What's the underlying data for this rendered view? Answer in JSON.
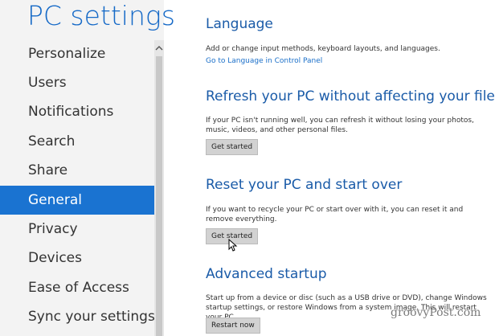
{
  "app_title": "PC settings",
  "sidebar": {
    "items": [
      {
        "label": "Personalize",
        "selected": false
      },
      {
        "label": "Users",
        "selected": false
      },
      {
        "label": "Notifications",
        "selected": false
      },
      {
        "label": "Search",
        "selected": false
      },
      {
        "label": "Share",
        "selected": false
      },
      {
        "label": "General",
        "selected": true
      },
      {
        "label": "Privacy",
        "selected": false
      },
      {
        "label": "Devices",
        "selected": false
      },
      {
        "label": "Ease of Access",
        "selected": false
      },
      {
        "label": "Sync your settings",
        "selected": false
      }
    ]
  },
  "sections": {
    "language": {
      "heading": "Language",
      "desc": "Add or change input methods, keyboard layouts, and languages.",
      "link": "Go to Language in Control Panel"
    },
    "refresh": {
      "heading": "Refresh your PC without affecting your files",
      "desc": "If your PC isn't running well, you can refresh it without losing your photos, music, videos, and other personal files.",
      "button": "Get started"
    },
    "reset": {
      "heading": "Reset your PC and start over",
      "desc": "If you want to recycle your PC or start over with it, you can reset it and remove everything.",
      "button": "Get started"
    },
    "advanced": {
      "heading": "Advanced startup",
      "desc": "Start up from a device or disc (such as a USB drive or DVD), change Windows startup settings, or restore Windows from a system image. This will restart your PC.",
      "button": "Restart now"
    }
  },
  "watermark": "groovyPost.com",
  "colors": {
    "accent": "#1a73d1",
    "title": "#1569c7",
    "heading": "#1a5ba8",
    "sidebar_bg": "#f3f3f3"
  },
  "icons": {
    "scroll_up": "chevron-up-icon",
    "cursor": "mouse-pointer-icon"
  }
}
